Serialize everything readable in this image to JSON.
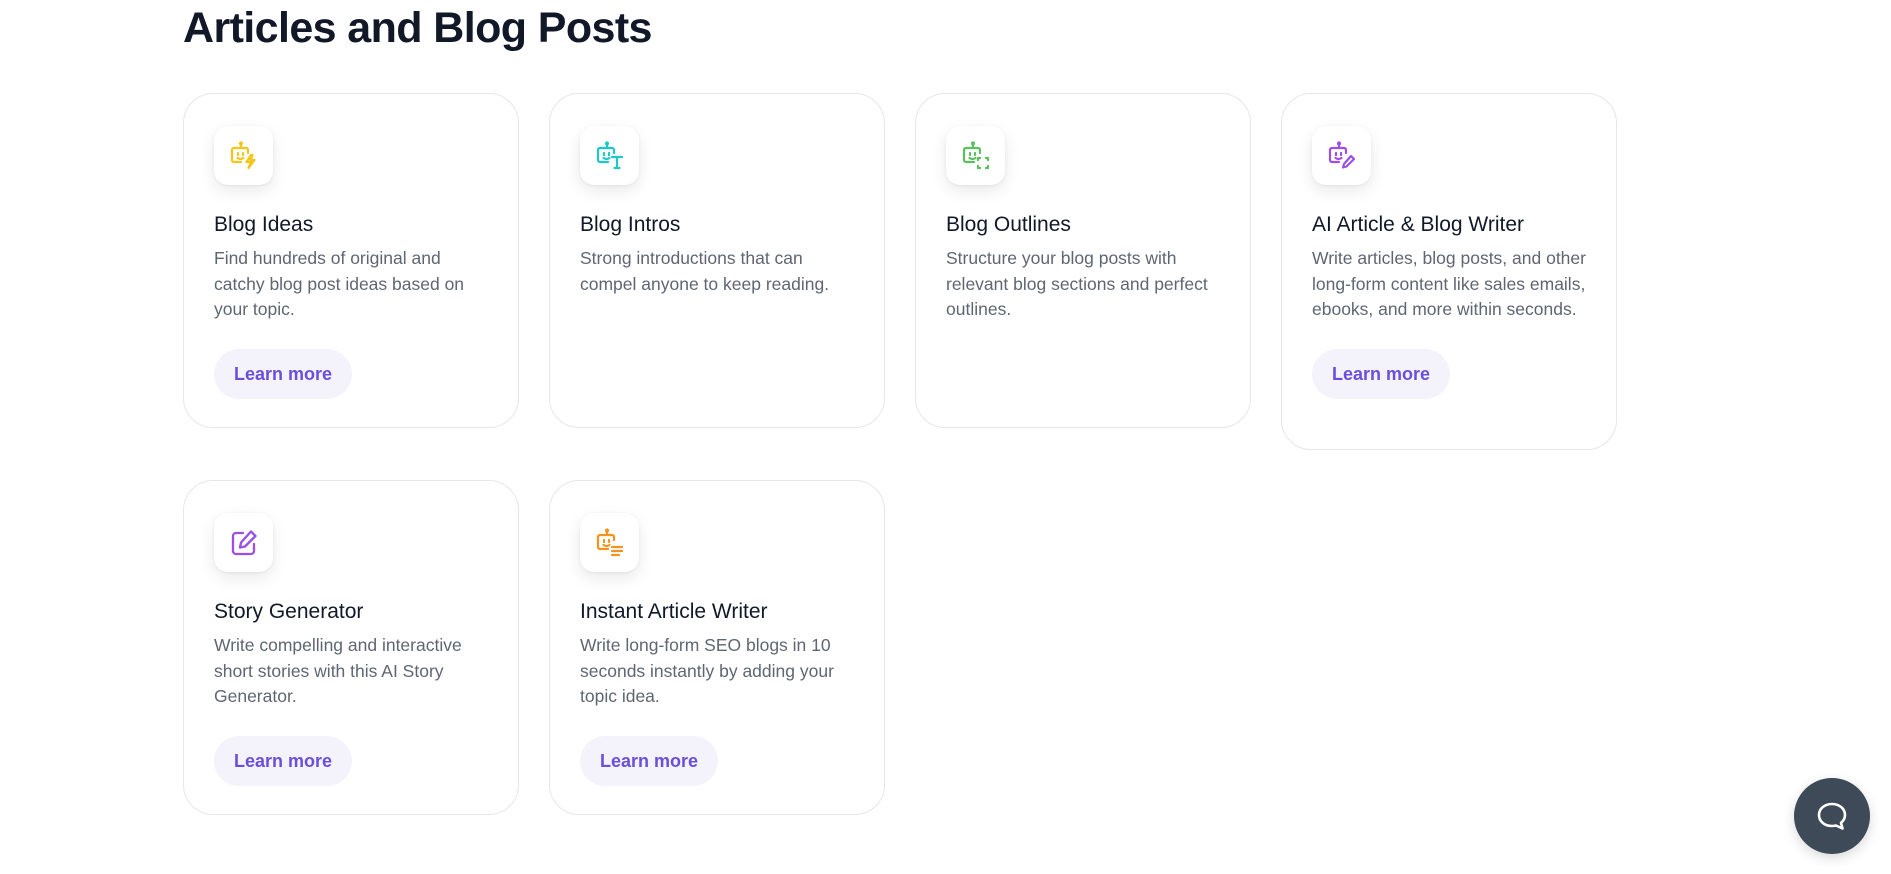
{
  "section": {
    "title": "Articles and Blog Posts"
  },
  "cards": [
    {
      "title": "Blog Ideas",
      "description": "Find hundreds of original and catchy blog post ideas based on your topic.",
      "button": "Learn more",
      "icon": "robot-bolt-icon",
      "color": "#f5c518"
    },
    {
      "title": "Blog Intros",
      "description": "Strong introductions that can compel anyone to keep reading.",
      "button": "",
      "icon": "robot-text-icon",
      "color": "#1cc9c9"
    },
    {
      "title": "Blog Outlines",
      "description": "Structure your blog posts with relevant blog sections and perfect outlines.",
      "button": "",
      "icon": "robot-scan-icon",
      "color": "#5cbf5e"
    },
    {
      "title": "AI Article & Blog Writer",
      "description": "Write articles, blog posts, and other long-form content like sales emails, ebooks, and more within seconds.",
      "button": "Learn more",
      "icon": "robot-pen-icon",
      "color": "#9b4fe6"
    },
    {
      "title": "Story Generator",
      "description": "Write compelling and interactive short stories with this AI Story Generator.",
      "button": "Learn more",
      "icon": "edit-square-icon",
      "color": "#9b4fe6"
    },
    {
      "title": "Instant Article Writer",
      "description": "Write long-form SEO blogs in 10 seconds instantly by adding your topic idea.",
      "button": "Learn more",
      "icon": "robot-lines-icon",
      "color": "#f5931f"
    }
  ],
  "chat": {
    "icon": "chat-bubble-icon"
  },
  "theme": {
    "accent": "#6a4fdc",
    "button_bg": "#f4f3fb",
    "fab_bg": "#3e4a57"
  }
}
